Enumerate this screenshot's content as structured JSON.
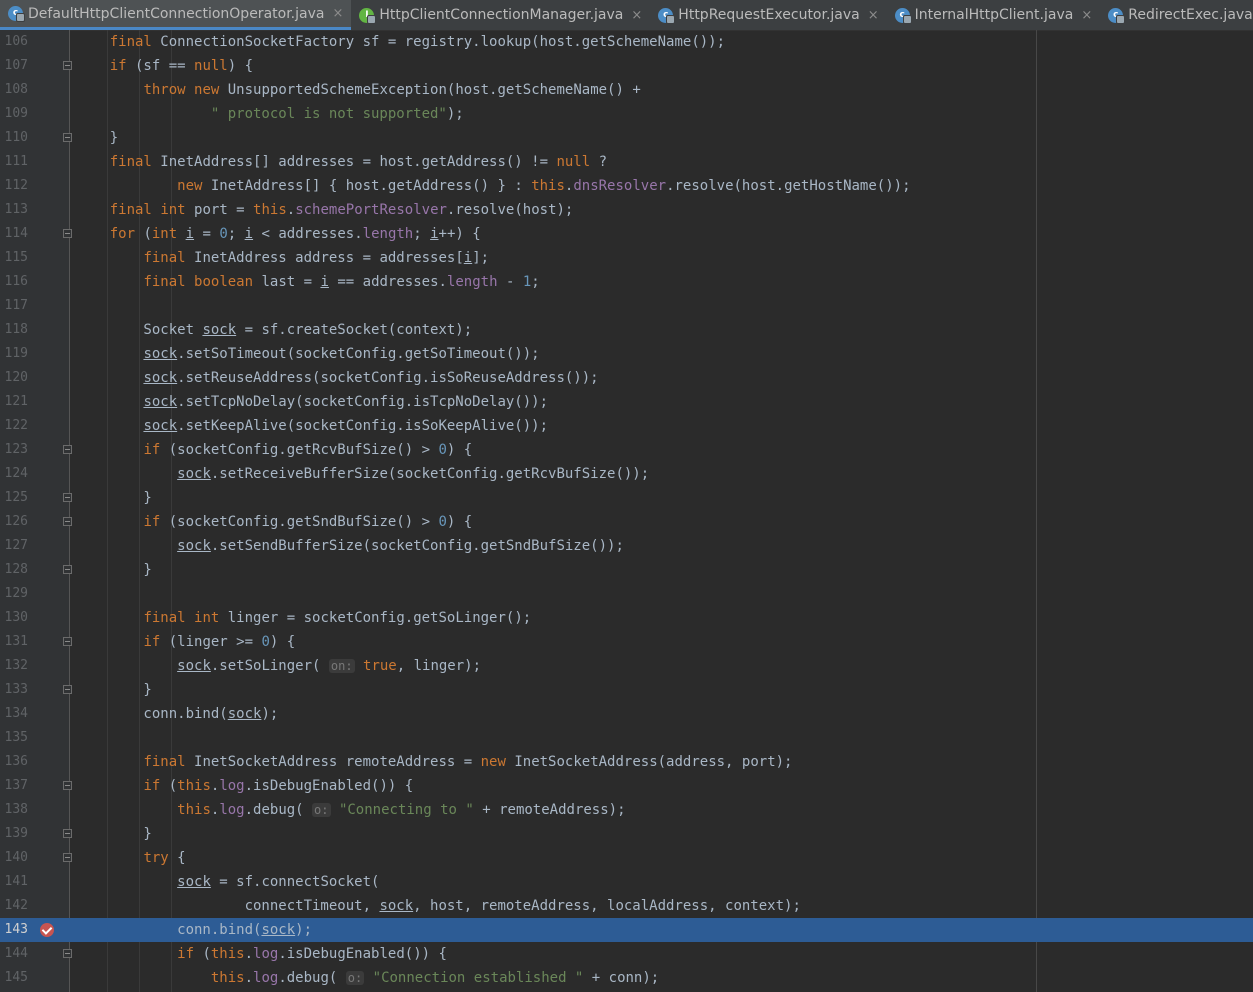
{
  "tabs": [
    {
      "label": "DefaultHttpClientConnectionOperator.java",
      "icon": "class-icon",
      "active": true,
      "close": "×"
    },
    {
      "label": "HttpClientConnectionManager.java",
      "icon": "interface-icon",
      "active": false,
      "close": "×"
    },
    {
      "label": "HttpRequestExecutor.java",
      "icon": "class-icon",
      "active": false,
      "close": "×"
    },
    {
      "label": "InternalHttpClient.java",
      "icon": "class-icon",
      "active": false,
      "close": "×"
    },
    {
      "label": "RedirectExec.java",
      "icon": "class-icon",
      "active": false,
      "close": ""
    }
  ],
  "editor": {
    "selected_line": "143",
    "breakpoint_line": "143",
    "lines": [
      {
        "n": "106",
        "code": "    final ConnectionSocketFactory sf = registry.lookup(host.getSchemeName());"
      },
      {
        "n": "107",
        "code": "    if (sf == null) {"
      },
      {
        "n": "108",
        "code": "        throw new UnsupportedSchemeException(host.getSchemeName() +"
      },
      {
        "n": "109",
        "code": "                \" protocol is not supported\");"
      },
      {
        "n": "110",
        "code": "    }"
      },
      {
        "n": "111",
        "code": "    final InetAddress[] addresses = host.getAddress() != null ?"
      },
      {
        "n": "112",
        "code": "            new InetAddress[] { host.getAddress() } : this.dnsResolver.resolve(host.getHostName());"
      },
      {
        "n": "113",
        "code": "    final int port = this.schemePortResolver.resolve(host);"
      },
      {
        "n": "114",
        "code": "    for (int i = 0; i < addresses.length; i++) {"
      },
      {
        "n": "115",
        "code": "        final InetAddress address = addresses[i];"
      },
      {
        "n": "116",
        "code": "        final boolean last = i == addresses.length - 1;"
      },
      {
        "n": "117",
        "code": ""
      },
      {
        "n": "118",
        "code": "        Socket sock = sf.createSocket(context);"
      },
      {
        "n": "119",
        "code": "        sock.setSoTimeout(socketConfig.getSoTimeout());"
      },
      {
        "n": "120",
        "code": "        sock.setReuseAddress(socketConfig.isSoReuseAddress());"
      },
      {
        "n": "121",
        "code": "        sock.setTcpNoDelay(socketConfig.isTcpNoDelay());"
      },
      {
        "n": "122",
        "code": "        sock.setKeepAlive(socketConfig.isSoKeepAlive());"
      },
      {
        "n": "123",
        "code": "        if (socketConfig.getRcvBufSize() > 0) {"
      },
      {
        "n": "124",
        "code": "            sock.setReceiveBufferSize(socketConfig.getRcvBufSize());"
      },
      {
        "n": "125",
        "code": "        }"
      },
      {
        "n": "126",
        "code": "        if (socketConfig.getSndBufSize() > 0) {"
      },
      {
        "n": "127",
        "code": "            sock.setSendBufferSize(socketConfig.getSndBufSize());"
      },
      {
        "n": "128",
        "code": "        }"
      },
      {
        "n": "129",
        "code": ""
      },
      {
        "n": "130",
        "code": "        final int linger = socketConfig.getSoLinger();"
      },
      {
        "n": "131",
        "code": "        if (linger >= 0) {"
      },
      {
        "n": "132",
        "code": "            sock.setSoLinger( on: true, linger);"
      },
      {
        "n": "133",
        "code": "        }"
      },
      {
        "n": "134",
        "code": "        conn.bind(sock);"
      },
      {
        "n": "135",
        "code": ""
      },
      {
        "n": "136",
        "code": "        final InetSocketAddress remoteAddress = new InetSocketAddress(address, port);"
      },
      {
        "n": "137",
        "code": "        if (this.log.isDebugEnabled()) {"
      },
      {
        "n": "138",
        "code": "            this.log.debug( o: \"Connecting to \" + remoteAddress);"
      },
      {
        "n": "139",
        "code": "        }"
      },
      {
        "n": "140",
        "code": "        try {"
      },
      {
        "n": "141",
        "code": "            sock = sf.connectSocket("
      },
      {
        "n": "142",
        "code": "                    connectTimeout, sock, host, remoteAddress, localAddress, context);"
      },
      {
        "n": "143",
        "code": "            conn.bind(sock);"
      },
      {
        "n": "144",
        "code": "            if (this.log.isDebugEnabled()) {"
      },
      {
        "n": "145",
        "code": "                this.log.debug( o: \"Connection established \" + conn);"
      }
    ]
  },
  "colors": {
    "keyword": "#cc7832",
    "string": "#6a8759",
    "number": "#6897bb",
    "field": "#9876aa",
    "text": "#a9b7c6",
    "selection": "#2d5c95",
    "breakpoint": "#c75450",
    "background": "#2b2b2b"
  }
}
